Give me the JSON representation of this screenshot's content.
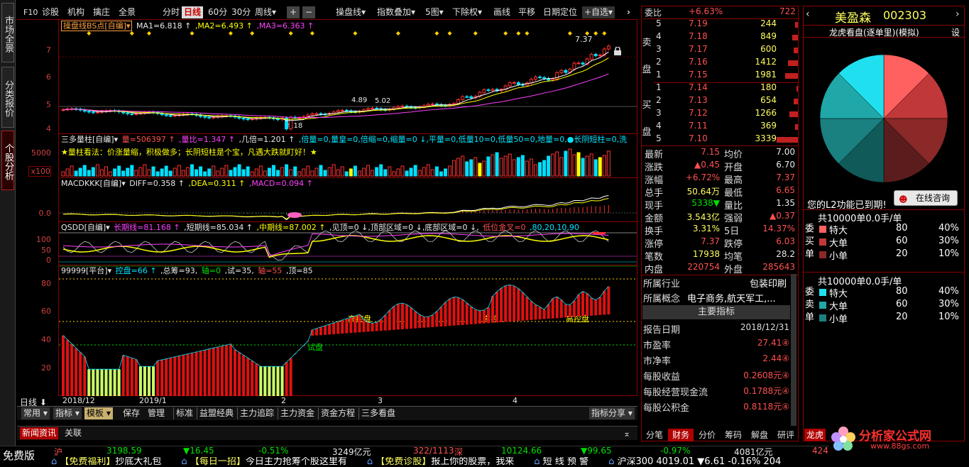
{
  "left_tabs": [
    "市场全景",
    "分类报价",
    "个股分析"
  ],
  "toolbar": {
    "f10": "F10",
    "diag": "诊股",
    "inst": "机构",
    "zhuang": "擒庄",
    "full": "全景",
    "periods": [
      "分时",
      "日线",
      "60分",
      "30分",
      "周线▾"
    ],
    "plus": "+",
    "minus": "−",
    "right_items": [
      "操盘线▾",
      "指数叠加▾",
      "5图▾",
      "下除权▾",
      "画线",
      "平移",
      "日期定位",
      "+自选▾"
    ],
    "arrow": "›"
  },
  "main_title": {
    "name": "操盘线BS点[自编]▾",
    "ma1": "MA1=6.818 ↑",
    "ma2": ",MA2=6.493 ↑",
    "ma3": ",MA3=6.363 ↑"
  },
  "price_axis": [
    "7",
    "6",
    "5",
    "4"
  ],
  "price_labels": {
    "high": "7.37",
    "mid": "4.89",
    "mid2": "5.02",
    "low": "4.18"
  },
  "vol_title": {
    "name": "三多量柱[自编]▾",
    "liang": "量=506397 ↑",
    "lb": ",量比=1.347 ↑",
    "jb": ",几倍=1.201 ↑",
    "rest": ",倍量=0,量皇=0,倍缩=0,缩量=0 ↓,平量=0,低量10=0,低量50=0,地量=0,●长阴短柱=0,洗"
  },
  "vol_note": "★量柱看法：价涨量缩，积极做多；长阴短柱是个宝，凡遇大跌就盯好！★",
  "vol_axis": [
    "5000",
    "x100"
  ],
  "vol_bei": "倍",
  "macd_title": {
    "name": "MACDKKK[自编]▾",
    "diff": "DIFF=0.358 ↑",
    "dea": ",DEA=0.311 ↑",
    "macd": ",MACD=0.094 ↑"
  },
  "macd_axis": [
    "0.0"
  ],
  "qsdd_title": {
    "name": "QSDD[自编]▾",
    "l": "长期线=81.168 ↑",
    "s": ",短期线=85.034 ↑",
    "m": ",中期线=87.002 ↑",
    "d": ",见顶=0 ↓,顶部区域=0 ↓,底部区域=0 ↓,",
    "j": "低位金叉=0",
    "v": ",80,20,10,90"
  },
  "qsdd_axis": [
    "100",
    "50",
    "0"
  ],
  "kp_title": {
    "name": "99999[平台]▾",
    "k": "控盘=66 ↑",
    "z": ",总筹=93,",
    "a": "轴=0",
    "t": ",试=35,",
    "b": "轴=55",
    "d": ",顶=85"
  },
  "kp_axis": [
    "80",
    "60",
    "40",
    "20"
  ],
  "kp_labels": [
    "高控盘",
    "高控",
    "高控盘",
    "试盘"
  ],
  "x_axis": {
    "period": "日线 ⬇",
    "dates": [
      "2018/12",
      "2019/1",
      "2",
      "3",
      "4"
    ]
  },
  "bottom_tabs": [
    "常用 ▾",
    "指标 ▾",
    "模板 ▾",
    "保存",
    "管理",
    "标准",
    "益盟经典",
    "主力追踪",
    "主力资金",
    "资金方程",
    "三多看盘"
  ],
  "share": "指标分享 ▾",
  "news_tabs": [
    "新闻资讯",
    "关联"
  ],
  "quote": {
    "wb_label": "委比",
    "wb_val": "+6.63%",
    "wb_n": "722",
    "sell": [
      [
        "5",
        "7.19",
        "244"
      ],
      [
        "4",
        "7.18",
        "849"
      ],
      [
        "3",
        "7.17",
        "600"
      ],
      [
        "2",
        "7.16",
        "1412"
      ],
      [
        "1",
        "7.15",
        "1981"
      ]
    ],
    "buy": [
      [
        "1",
        "7.14",
        "180"
      ],
      [
        "2",
        "7.13",
        "654"
      ],
      [
        "3",
        "7.12",
        "1266"
      ],
      [
        "4",
        "7.11",
        "369"
      ],
      [
        "5",
        "7.10",
        "3339"
      ]
    ],
    "sell_side": [
      "卖",
      "盘"
    ],
    "buy_side": [
      "买",
      "盘"
    ],
    "stats": [
      [
        "最新",
        "7.15",
        "均价",
        "7.00"
      ],
      [
        "涨跌",
        "▲0.45",
        "开盘",
        "6.70"
      ],
      [
        "涨幅",
        "+6.72%",
        "最高",
        "7.37"
      ],
      [
        "总手",
        "50.64万",
        "最低",
        "6.65"
      ],
      [
        "现手",
        "5338▼",
        "量比",
        "1.35"
      ],
      [
        "金额",
        "3.543亿",
        "强弱",
        "▲0.37"
      ],
      [
        "换手",
        "3.31%",
        "5日",
        "14.37%"
      ],
      [
        "涨停",
        "7.37",
        "跌停",
        "6.03"
      ],
      [
        "笔数",
        "17938",
        "均笔",
        "28.2"
      ],
      [
        "内盘",
        "220754",
        "外盘",
        "285643"
      ]
    ],
    "industry_label": "所属行业",
    "industry": "包装印刷",
    "concept_label": "所属概念",
    "concept": "电子商务,航天军工,...",
    "main_idx": "主要指标",
    "fin": [
      [
        "报告日期",
        "2018/12/31"
      ],
      [
        "市盈率",
        "27.41④"
      ],
      [
        "市净率",
        "2.44④"
      ],
      [
        "每股收益",
        "0.2608元④"
      ],
      [
        "每股经营现金流",
        "0.1788元④"
      ],
      [
        "每股公积金",
        "0.8118元④"
      ]
    ],
    "tabs": [
      "分笔",
      "财务",
      "分价",
      "筹码",
      "解盘",
      "研评"
    ]
  },
  "stock": {
    "name": "美盈森",
    "code": "002303",
    "lhb": "龙虎看盘(逐单里)(模拟)",
    "set": "设",
    "l2": "您的L2功能已到期!",
    "consult": "在线咨询",
    "lh": "龙虎"
  },
  "buy_table": {
    "header": "共10000单0.0手/单",
    "side": [
      "委",
      "买",
      "单"
    ],
    "rows": [
      [
        "特大",
        "80",
        "40%"
      ],
      [
        "大单",
        "60",
        "30%"
      ],
      [
        "小单",
        "20",
        "10%"
      ]
    ]
  },
  "sell_table": {
    "header": "共10000单0.0手/单",
    "side": [
      "委",
      "卖",
      "单"
    ],
    "rows": [
      [
        "特大",
        "80",
        "40%"
      ],
      [
        "大单",
        "60",
        "30%"
      ],
      [
        "小单",
        "20",
        "10%"
      ]
    ]
  },
  "pie": {
    "slices": [
      {
        "value": 12.5,
        "color": "#ff6060"
      },
      {
        "value": 12.5,
        "color": "#c03838"
      },
      {
        "value": 12.5,
        "color": "#8b2828"
      },
      {
        "value": 12.5,
        "color": "#5a1c1c"
      },
      {
        "value": 12.5,
        "color": "#105a5a"
      },
      {
        "value": 12.5,
        "color": "#1a8080"
      },
      {
        "value": 12.5,
        "color": "#20a8a8"
      },
      {
        "value": 12.5,
        "color": "#20e0f0"
      }
    ]
  },
  "ticker": {
    "free": "免费版",
    "sh": "沪",
    "sh_val": "3198.59",
    "sh_chg": "▼16.45",
    "sh_pct": "-0.51%",
    "sh_amt": "3249亿元",
    "sh_ud": "322/1113",
    "sz": "深",
    "sz_val": "10124.66",
    "sz_chg": "▼99.65",
    "sz_pct": "-0.97%",
    "sz_amt": "4081亿元",
    "sz_n": "424"
  },
  "scroll": [
    {
      "tag": "【免费福利】",
      "text": "抄底大礼包"
    },
    {
      "tag": "【每日一招】",
      "text": "今日主力抢筹个股这里有"
    },
    {
      "tag": "【免费诊股】",
      "text": "报上你的股票，我来"
    },
    {
      "tag": "",
      "text": "短 线 预 警"
    },
    {
      "tag": "",
      "text": "沪深300 4019.01 ▼6.61 -0.16% 204"
    }
  ],
  "watermark": {
    "title": "分析家公式网",
    "url": "www.88gs.com"
  }
}
